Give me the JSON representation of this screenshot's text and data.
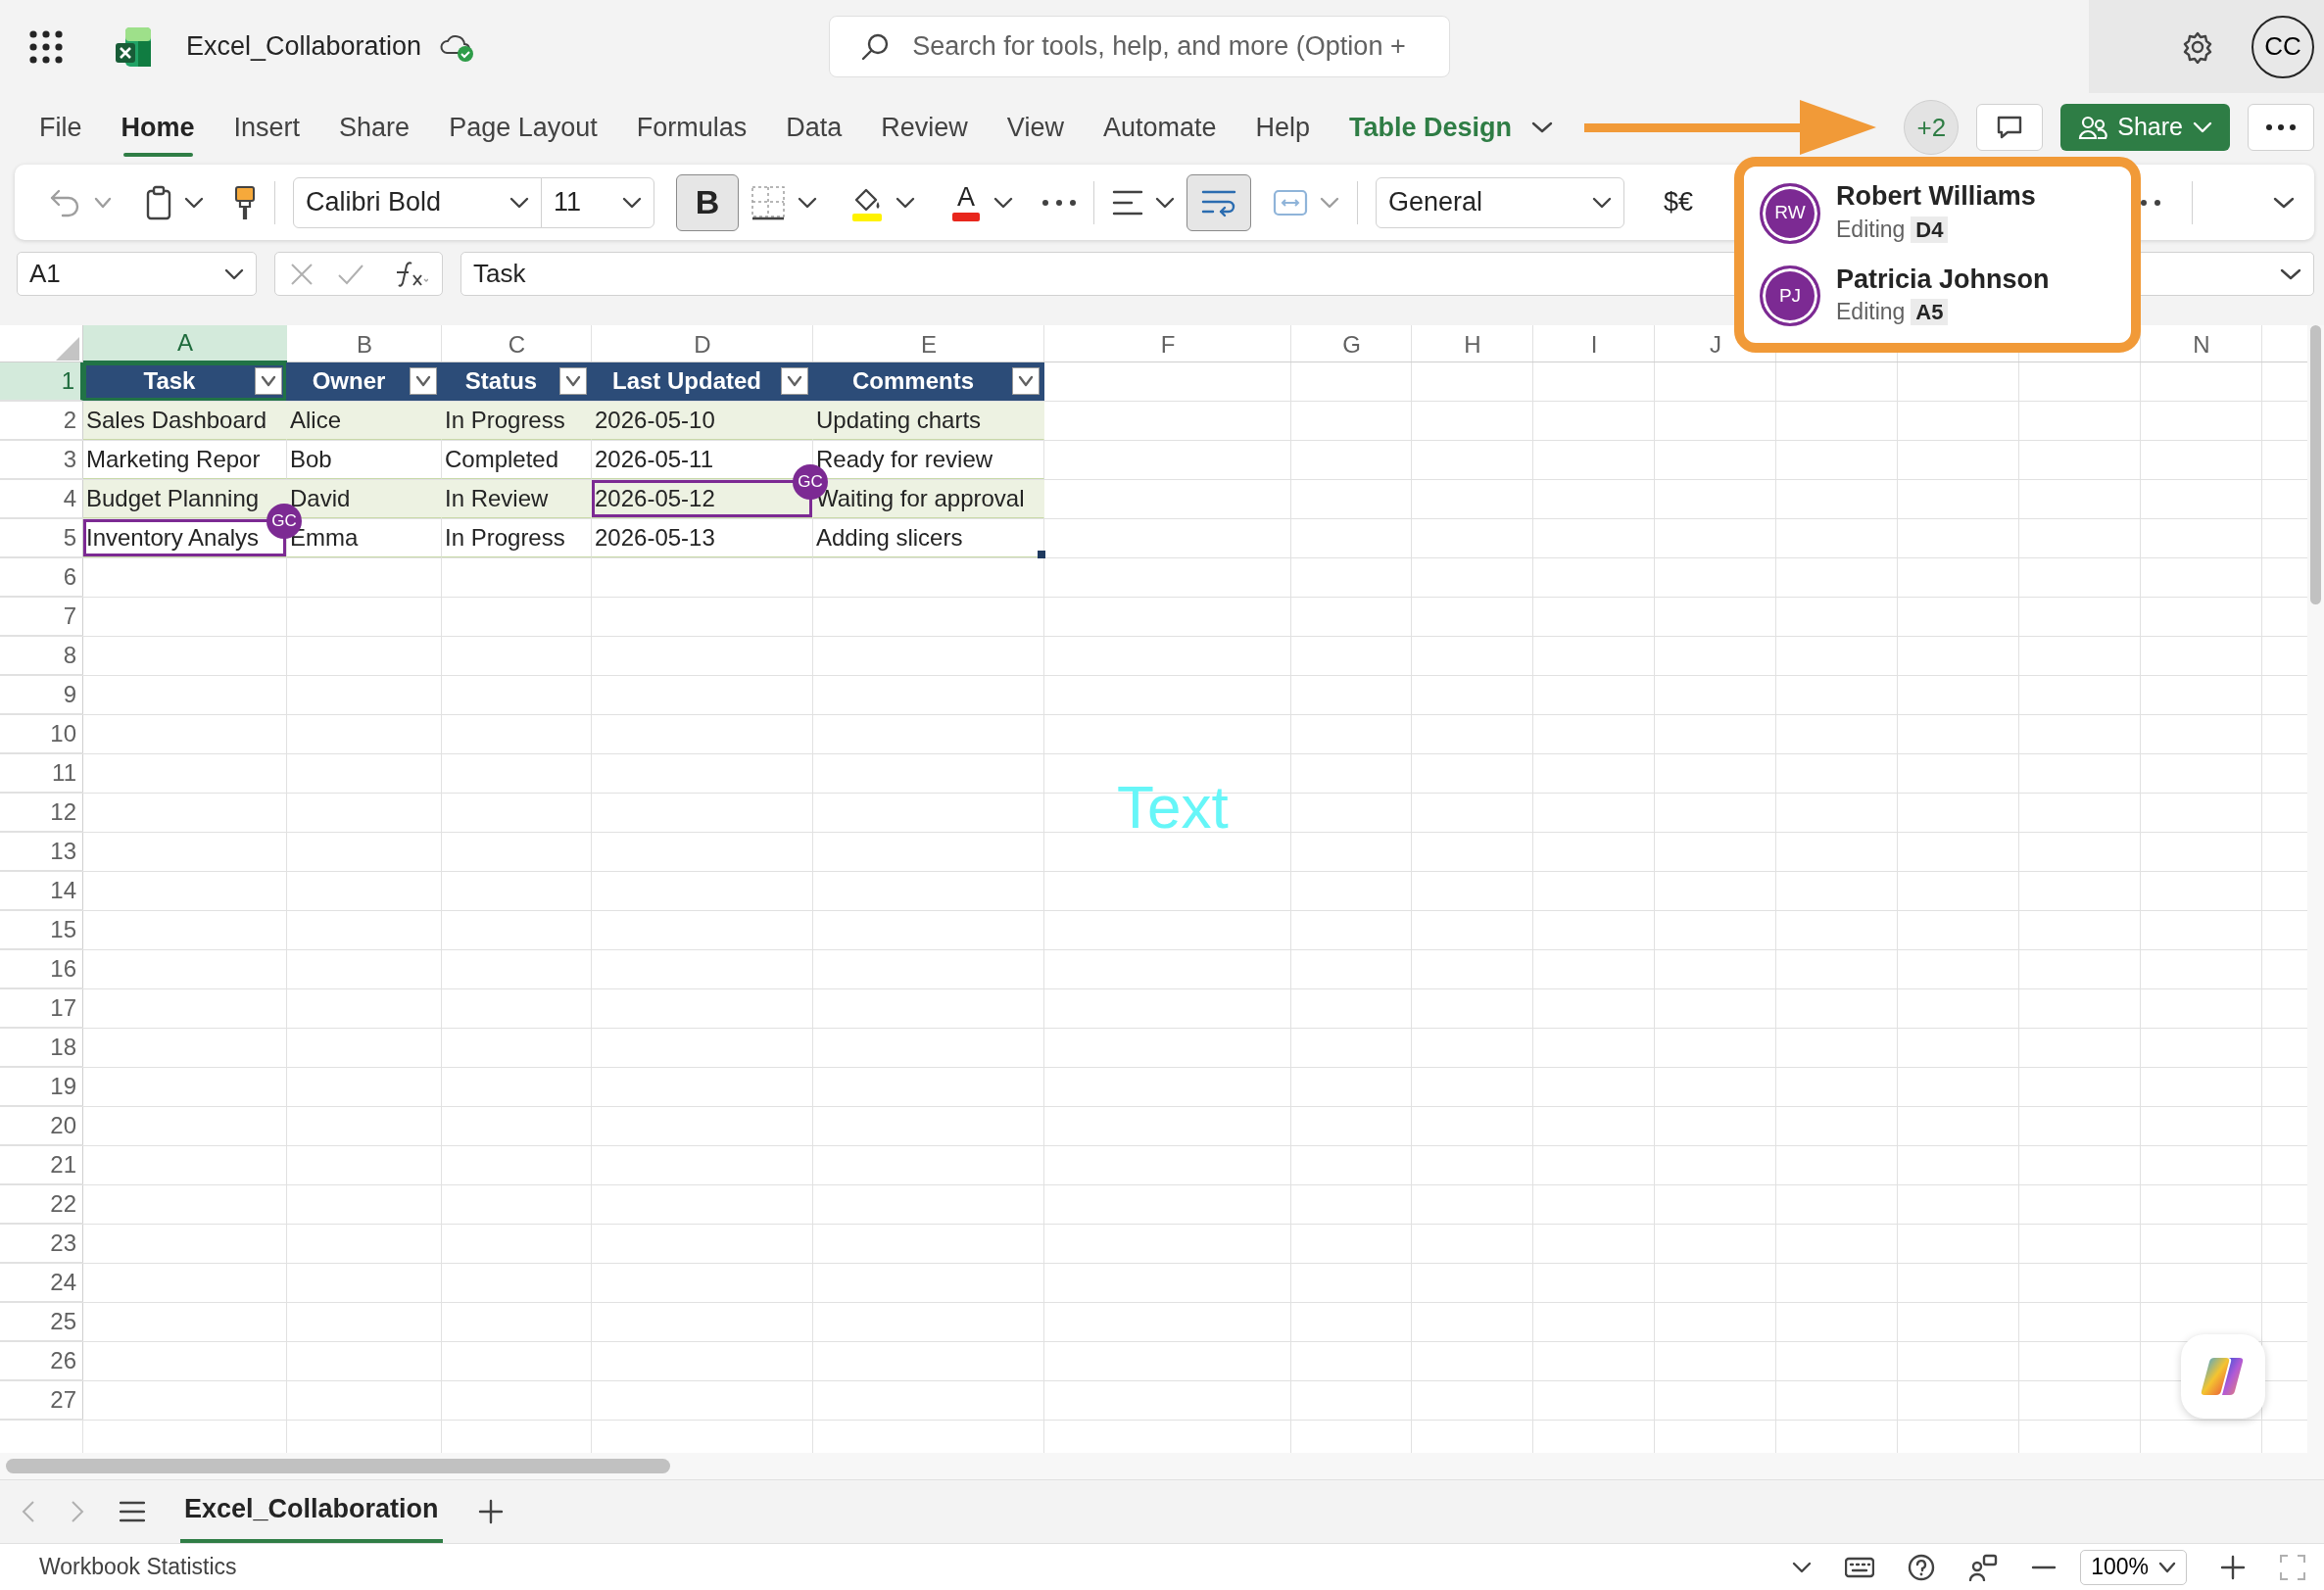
{
  "app": {
    "title": "Excel_Collaboration",
    "search": {
      "placeholder": "Search for tools, help, and more (Option +"
    },
    "account": "CC"
  },
  "menu_tabs": [
    {
      "label": "File",
      "selected": false,
      "kind": "standard"
    },
    {
      "label": "Home",
      "selected": true,
      "kind": "standard"
    },
    {
      "label": "Insert",
      "selected": false,
      "kind": "standard"
    },
    {
      "label": "Share",
      "selected": false,
      "kind": "standard"
    },
    {
      "label": "Page Layout",
      "selected": false,
      "kind": "standard"
    },
    {
      "label": "Formulas",
      "selected": false,
      "kind": "standard"
    },
    {
      "label": "Data",
      "selected": false,
      "kind": "standard"
    },
    {
      "label": "Review",
      "selected": false,
      "kind": "standard"
    },
    {
      "label": "View",
      "selected": false,
      "kind": "standard"
    },
    {
      "label": "Automate",
      "selected": false,
      "kind": "standard"
    },
    {
      "label": "Help",
      "selected": false,
      "kind": "standard"
    },
    {
      "label": "Table Design",
      "selected": false,
      "kind": "contextual"
    }
  ],
  "collaborators": {
    "count": "+2",
    "share_label": "Share",
    "list": [
      {
        "initials": "RW",
        "name": "Robert Williams",
        "status": "Editing",
        "cell": "D4"
      },
      {
        "initials": "PJ",
        "name": "Patricia Johnson",
        "status": "Editing",
        "cell": "A5"
      }
    ]
  },
  "ribbon": {
    "font": "Calibri Bold",
    "size": "11",
    "bold_label": "B",
    "bold_pressed": true,
    "font_color_label": "A",
    "wrap_pressed": true,
    "number_format": "General",
    "currency": "$€"
  },
  "formula_bar": {
    "name_box": "A1",
    "formula": "Task"
  },
  "sheet": {
    "columns": [
      {
        "label": "A",
        "selected": true
      },
      {
        "label": "B",
        "selected": false
      },
      {
        "label": "C",
        "selected": false
      },
      {
        "label": "D",
        "selected": false
      },
      {
        "label": "E",
        "selected": false
      },
      {
        "label": "F",
        "selected": false
      },
      {
        "label": "G",
        "selected": false
      },
      {
        "label": "H",
        "selected": false
      },
      {
        "label": "I",
        "selected": false
      },
      {
        "label": "J",
        "selected": false
      },
      {
        "label": "N",
        "selected": false
      }
    ],
    "rows": [
      {
        "number": "1",
        "selected": true,
        "kind": "header",
        "cells": [
          "Task",
          "Owner",
          "Status",
          "Last Updated",
          "Comments"
        ]
      },
      {
        "number": "2",
        "selected": false,
        "kind": "data",
        "cells": [
          "Sales Dashboard",
          "Alice",
          "In Progress",
          "2026-05-10",
          "Updating charts"
        ]
      },
      {
        "number": "3",
        "selected": false,
        "kind": "data",
        "cells": [
          "Marketing Repor",
          "Bob",
          "Completed",
          "2026-05-11",
          "Ready for review"
        ]
      },
      {
        "number": "4",
        "selected": false,
        "kind": "data",
        "cells": [
          "Budget Planning",
          "David",
          "In Review",
          {
            "text": "2026-05-12",
            "editor": "GC"
          },
          "Waiting for approval"
        ]
      },
      {
        "number": "5",
        "selected": false,
        "kind": "data",
        "cells": [
          {
            "text": "Inventory Analys",
            "editor": "GC"
          },
          "Emma",
          "In Progress",
          "2026-05-13",
          "Adding slicers"
        ]
      },
      {
        "number": "6",
        "selected": false,
        "kind": "empty"
      },
      {
        "number": "7",
        "selected": false,
        "kind": "empty"
      },
      {
        "number": "8",
        "selected": false,
        "kind": "empty"
      },
      {
        "number": "9",
        "selected": false,
        "kind": "empty"
      },
      {
        "number": "10",
        "selected": false,
        "kind": "empty"
      },
      {
        "number": "11",
        "selected": false,
        "kind": "empty"
      },
      {
        "number": "12",
        "selected": false,
        "kind": "empty"
      },
      {
        "number": "13",
        "selected": false,
        "kind": "empty"
      },
      {
        "number": "14",
        "selected": false,
        "kind": "empty"
      },
      {
        "number": "15",
        "selected": false,
        "kind": "empty"
      },
      {
        "number": "16",
        "selected": false,
        "kind": "empty"
      },
      {
        "number": "17",
        "selected": false,
        "kind": "empty"
      },
      {
        "number": "18",
        "selected": false,
        "kind": "empty"
      },
      {
        "number": "19",
        "selected": false,
        "kind": "empty"
      },
      {
        "number": "20",
        "selected": false,
        "kind": "empty"
      },
      {
        "number": "21",
        "selected": false,
        "kind": "empty"
      },
      {
        "number": "22",
        "selected": false,
        "kind": "empty"
      },
      {
        "number": "23",
        "selected": false,
        "kind": "empty"
      },
      {
        "number": "24",
        "selected": false,
        "kind": "empty"
      },
      {
        "number": "25",
        "selected": false,
        "kind": "empty"
      },
      {
        "number": "26",
        "selected": false,
        "kind": "empty"
      },
      {
        "number": "27",
        "selected": false,
        "kind": "empty"
      }
    ],
    "text_box": "Text"
  },
  "sheet_tabs": [
    {
      "label": "Excel_Collaboration",
      "selected": true
    }
  ],
  "status_bar": {
    "text": "Workbook Statistics",
    "zoom": "100%"
  }
}
